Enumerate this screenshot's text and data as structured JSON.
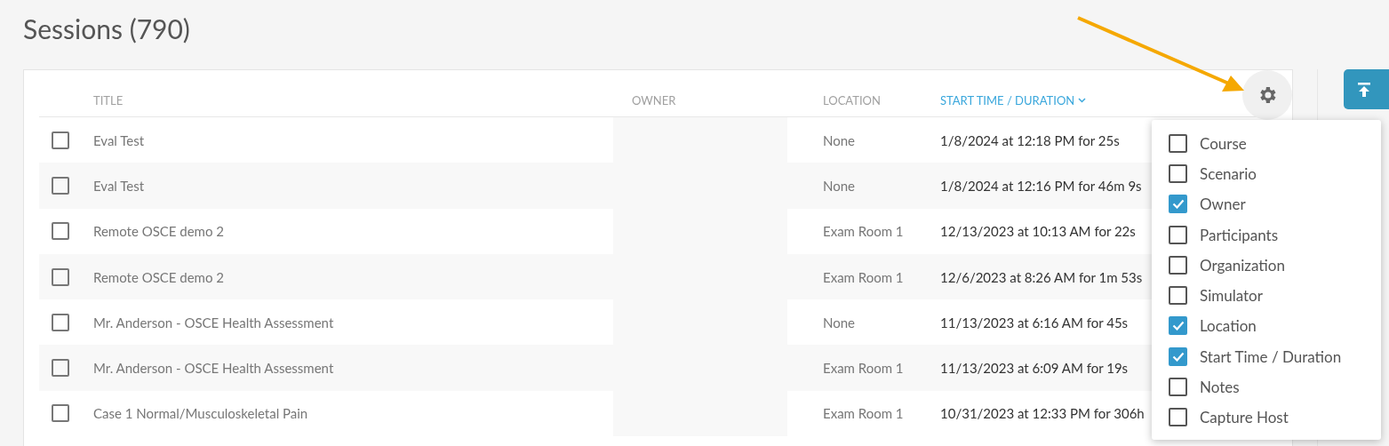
{
  "page": {
    "title": "Sessions (790)"
  },
  "table": {
    "columns": [
      {
        "label": "TITLE",
        "sorted": false
      },
      {
        "label": "OWNER",
        "sorted": false
      },
      {
        "label": "LOCATION",
        "sorted": false
      },
      {
        "label": "START TIME / DURATION",
        "sorted": true
      }
    ],
    "rows": [
      {
        "checked": false,
        "title": "Eval Test",
        "location": "None",
        "start": "1/8/2024 at 12:18 PM for 25s"
      },
      {
        "checked": false,
        "title": "Eval Test",
        "location": "None",
        "start": "1/8/2024 at 12:16 PM for 46m 9s"
      },
      {
        "checked": false,
        "title": "Remote OSCE demo 2",
        "location": "Exam Room 1",
        "start": "12/13/2023 at 10:13 AM for 22s"
      },
      {
        "checked": false,
        "title": "Remote OSCE demo 2",
        "location": "Exam Room 1",
        "start": "12/6/2023 at 8:26 AM for 1m 53s"
      },
      {
        "checked": false,
        "title": "Mr. Anderson - OSCE Health Assessment",
        "location": "None",
        "start": "11/13/2023 at 6:16 AM for 45s"
      },
      {
        "checked": false,
        "title": "Mr. Anderson - OSCE Health Assessment",
        "location": "Exam Room 1",
        "start": "11/13/2023 at 6:09 AM for 19s"
      },
      {
        "checked": false,
        "title": "Case 1 Normal/Musculoskeletal Pain",
        "location": "Exam Room 1",
        "start": "10/31/2023 at 12:33 PM for 306h"
      }
    ]
  },
  "column_menu": {
    "items": [
      {
        "label": "Course",
        "checked": false
      },
      {
        "label": "Scenario",
        "checked": false
      },
      {
        "label": "Owner",
        "checked": true
      },
      {
        "label": "Participants",
        "checked": false
      },
      {
        "label": "Organization",
        "checked": false
      },
      {
        "label": "Simulator",
        "checked": false
      },
      {
        "label": "Location",
        "checked": true
      },
      {
        "label": "Start Time / Duration",
        "checked": true
      },
      {
        "label": "Notes",
        "checked": false
      },
      {
        "label": "Capture Host",
        "checked": false
      }
    ]
  }
}
